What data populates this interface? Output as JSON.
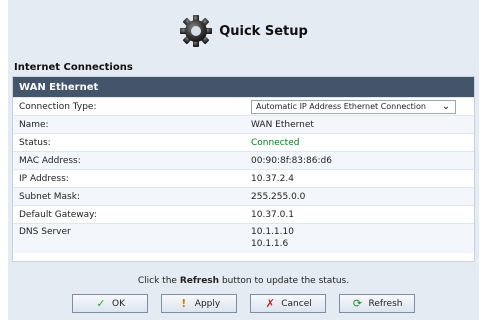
{
  "header": {
    "title": "Quick Setup"
  },
  "section": {
    "title": "Internet Connections"
  },
  "table": {
    "band_title": "WAN Ethernet",
    "rows": [
      {
        "key": "Connection Type:",
        "value": "Automatic IP Address Ethernet Connection"
      },
      {
        "key": "Name:",
        "value": "WAN Ethernet"
      },
      {
        "key": "Status:",
        "value": "Connected"
      },
      {
        "key": "MAC Address:",
        "value": "00:90:8f:83:86:d6"
      },
      {
        "key": "IP Address:",
        "value": "10.37.2.4"
      },
      {
        "key": "Subnet Mask:",
        "value": "255.255.0.0"
      },
      {
        "key": "Default Gateway:",
        "value": "10.37.0.1"
      },
      {
        "key": "DNS Server",
        "values": [
          "10.1.1.10",
          "10.1.1.6"
        ]
      }
    ]
  },
  "note": {
    "pre": "Click the ",
    "bold": "Refresh",
    "post": " button to update the status."
  },
  "buttons": {
    "ok": "OK",
    "apply": "Apply",
    "cancel": "Cancel",
    "refresh": "Refresh"
  }
}
